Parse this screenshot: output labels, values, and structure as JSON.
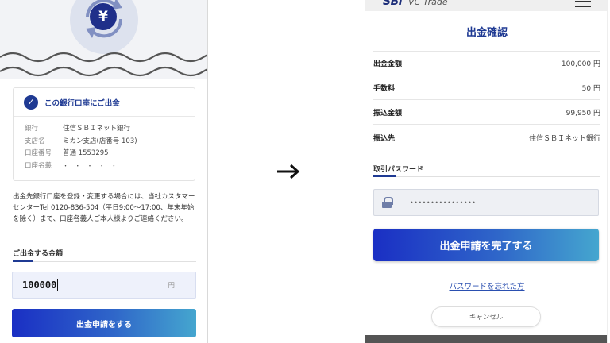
{
  "left_panel": {
    "icon": "yen-exchange-icon",
    "yen_symbol": "¥",
    "bank_card": {
      "title": "この銀行口座にご出金",
      "rows": [
        {
          "key": "銀行",
          "value": "住信ＳＢＩネット銀行"
        },
        {
          "key": "支店名",
          "value": "ミカン支店(店番号 103)"
        },
        {
          "key": "口座番号",
          "value": "普通 1553295"
        },
        {
          "key": "口座名義",
          "value": "・ ・ ・ ・ ・"
        }
      ]
    },
    "notice": "出金先銀行口座を登録・変更する場合には、当社カスタマーセンターTel 0120-836-504（平日9:00～17:00、年末年始を除く）まで、口座名義人ご本人様よりご連絡ください。",
    "amount": {
      "label": "ご出金する金額",
      "value": "100000",
      "unit": "円"
    },
    "submit_label": "出金申請をする"
  },
  "right_panel": {
    "brand": {
      "logo": "SBI",
      "product": "VC Trade"
    },
    "title": "出金確認",
    "details": [
      {
        "key": "出金金額",
        "value": "100,000 円"
      },
      {
        "key": "手数料",
        "value": "50 円"
      },
      {
        "key": "振込金額",
        "value": "99,950 円"
      },
      {
        "key": "振込先",
        "value": "住信ＳＢＩネット銀行"
      }
    ],
    "password": {
      "label": "取引パスワード",
      "value": "••••••••••••••••"
    },
    "submit_label": "出金申請を完了する",
    "forgot_label": "パスワードを忘れた方",
    "cancel_label": "キャンセル"
  },
  "colors": {
    "brand_navy": "#1f3a93",
    "gradient_start": "#1a2fc4",
    "gradient_end": "#45a6cf",
    "link": "#2a4fb0"
  }
}
